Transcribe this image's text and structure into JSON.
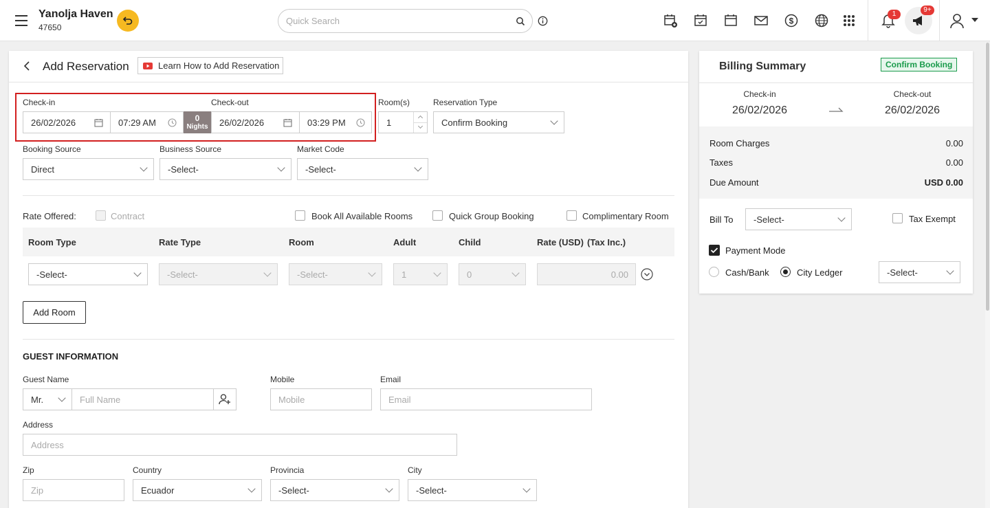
{
  "app": {
    "hotel_name": "Yanolja Haven",
    "hotel_id": "47650",
    "search_placeholder": "Quick Search",
    "notif_count": "1",
    "announce_count": "9+"
  },
  "page": {
    "title": "Add Reservation",
    "learn_label": "Learn How to Add Reservation"
  },
  "stay": {
    "checkin_label": "Check-in",
    "checkin_date": "26/02/2026",
    "checkin_time": "07:29 AM",
    "nights_value": "0",
    "nights_label": "Nights",
    "checkout_label": "Check-out",
    "checkout_date": "26/02/2026",
    "checkout_time": "03:29 PM",
    "rooms_label": "Room(s)",
    "rooms_value": "1",
    "res_type_label": "Reservation Type",
    "res_type_value": "Confirm Booking"
  },
  "sources": {
    "booking_label": "Booking Source",
    "booking_value": "Direct",
    "business_label": "Business Source",
    "business_value": "-Select-",
    "market_label": "Market Code",
    "market_value": "-Select-"
  },
  "rate": {
    "offered_label": "Rate Offered:",
    "contract_label": "Contract",
    "book_all_label": "Book All Available Rooms",
    "quick_group_label": "Quick Group Booking",
    "complimentary_label": "Complimentary Room"
  },
  "room_table": {
    "headers": [
      "Room Type",
      "Rate Type",
      "Room",
      "Adult",
      "Child",
      "Rate (USD)",
      "(Tax Inc.)"
    ],
    "row": {
      "room_type": "-Select-",
      "rate_type": "-Select-",
      "room": "-Select-",
      "adult": "1",
      "child": "0",
      "rate": "0.00"
    },
    "add_room_label": "Add Room"
  },
  "guest": {
    "section_title": "GUEST INFORMATION",
    "name_label": "Guest Name",
    "salutation": "Mr.",
    "name_placeholder": "Full Name",
    "mobile_label": "Mobile",
    "mobile_placeholder": "Mobile",
    "email_label": "Email",
    "email_placeholder": "Email",
    "address_label": "Address",
    "address_placeholder": "Address",
    "zip_label": "Zip",
    "zip_placeholder": "Zip",
    "country_label": "Country",
    "country_value": "Ecuador",
    "provincia_label": "Provincia",
    "provincia_value": "-Select-",
    "city_label": "City",
    "city_value": "-Select-"
  },
  "billing": {
    "title": "Billing Summary",
    "badge": "Confirm Booking",
    "checkin_label": "Check-in",
    "checkin_date": "26/02/2026",
    "checkout_label": "Check-out",
    "checkout_date": "26/02/2026",
    "room_charges_label": "Room Charges",
    "room_charges_value": "0.00",
    "taxes_label": "Taxes",
    "taxes_value": "0.00",
    "due_label": "Due Amount",
    "due_value": "USD 0.00",
    "bill_to_label": "Bill To",
    "bill_to_value": "-Select-",
    "tax_exempt_label": "Tax Exempt",
    "payment_mode_label": "Payment Mode",
    "cash_bank_label": "Cash/Bank",
    "city_ledger_label": "City Ledger",
    "ledger_value": "-Select-"
  },
  "colors": {
    "accent_yellow": "#f6b921",
    "highlight_red": "#d21f1f",
    "badge_green": "#1a9b4b",
    "notif_red": "#e53935",
    "nights_bg": "#8a7f7f"
  }
}
